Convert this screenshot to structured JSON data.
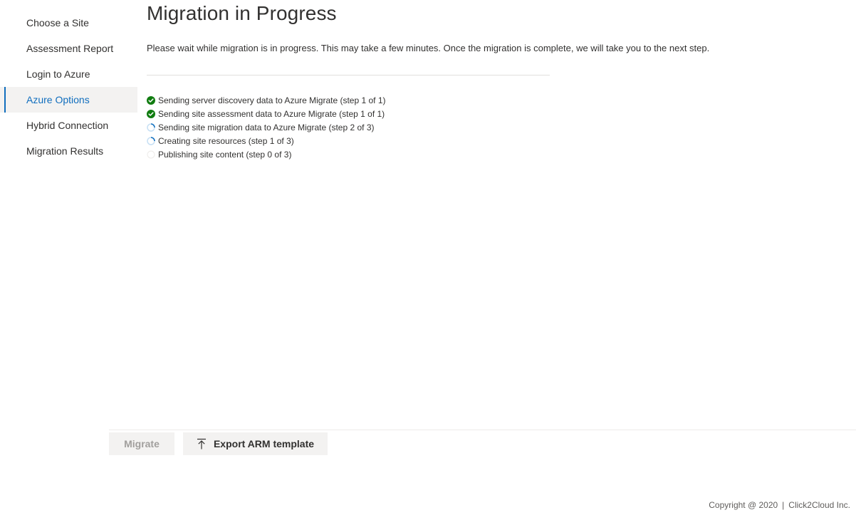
{
  "sidebar": {
    "items": [
      {
        "label": "Choose a Site",
        "active": false
      },
      {
        "label": "Assessment Report",
        "active": false
      },
      {
        "label": "Login to Azure",
        "active": false
      },
      {
        "label": "Azure Options",
        "active": true
      },
      {
        "label": "Hybrid Connection",
        "active": false
      },
      {
        "label": "Migration Results",
        "active": false
      }
    ]
  },
  "main": {
    "title": "Migration in Progress",
    "description": "Please wait while migration is in progress. This may take a few minutes. Once the migration is complete, we will take you to the next step.",
    "steps": [
      {
        "label": "Sending server discovery data to Azure Migrate (step 1 of 1)",
        "status": "complete",
        "icon": "check-circle-icon"
      },
      {
        "label": "Sending site assessment data to Azure Migrate (step 1 of 1)",
        "status": "complete",
        "icon": "check-circle-icon"
      },
      {
        "label": "Sending site migration data to Azure Migrate (step 2 of 3)",
        "status": "in-progress",
        "icon": "spinner-icon"
      },
      {
        "label": "Creating site resources (step 1 of 3)",
        "status": "in-progress",
        "icon": "spinner-icon"
      },
      {
        "label": "Publishing site content (step 0 of 3)",
        "status": "pending",
        "icon": "empty-circle-icon"
      }
    ]
  },
  "footer": {
    "migrate_label": "Migrate",
    "export_label": "Export ARM template",
    "export_icon": "upload-icon",
    "copyright": "Copyright @ 2020",
    "separator": "|",
    "company": "Click2Cloud Inc."
  },
  "colors": {
    "accent": "#106ebe",
    "success": "#107c10",
    "spinner_track": "#c7e0f4"
  }
}
